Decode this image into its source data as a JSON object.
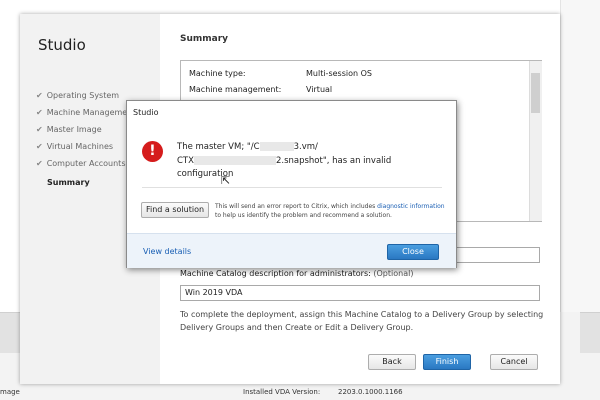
{
  "wizard": {
    "title": "Studio",
    "nav": [
      {
        "label": "Operating System",
        "done": true
      },
      {
        "label": "Machine Management",
        "done": true
      },
      {
        "label": "Master Image",
        "done": true
      },
      {
        "label": "Virtual Machines",
        "done": true
      },
      {
        "label": "Computer Accounts",
        "done": true
      },
      {
        "label": "Summary",
        "done": false
      }
    ],
    "section_title": "Summary",
    "summary_rows": [
      {
        "key": "Machine type:",
        "value": "Multi-session OS"
      },
      {
        "key": "Machine management:",
        "value": "Virtual"
      }
    ],
    "description_label": "Machine Catalog description for administrators:",
    "description_optional": "(Optional)",
    "description_value": "Win 2019 VDA",
    "info_text": "To complete the deployment, assign this Machine Catalog to a Delivery Group by selecting Delivery Groups and then Create or Edit a Delivery Group.",
    "buttons": {
      "back": "Back",
      "finish": "Finish",
      "cancel": "Cancel"
    }
  },
  "dialog": {
    "title": "Studio",
    "error_icon": "!",
    "message_line1_a": "The master VM; \"/C",
    "message_line1_b": "3.vm/",
    "message_line2_a": "CTX",
    "message_line2_b": "2.snapshot\", has an invalid",
    "message_line3": "configuration",
    "find_button": "Find a solution",
    "report_text_a": "This will send an error report to Citrix, which includes ",
    "report_link": "diagnostic information",
    "report_text_b": " to help us identify the problem and recommend a solution.",
    "view_details": "View details",
    "close_button": "Close"
  },
  "background": {
    "left_text": "mage",
    "vda_label": "Installed VDA Version:",
    "vda_value": "2203.0.1000.1166"
  },
  "colors": {
    "accent": "#2a78c2",
    "error": "#d51c1c",
    "link": "#1a5fb4"
  }
}
